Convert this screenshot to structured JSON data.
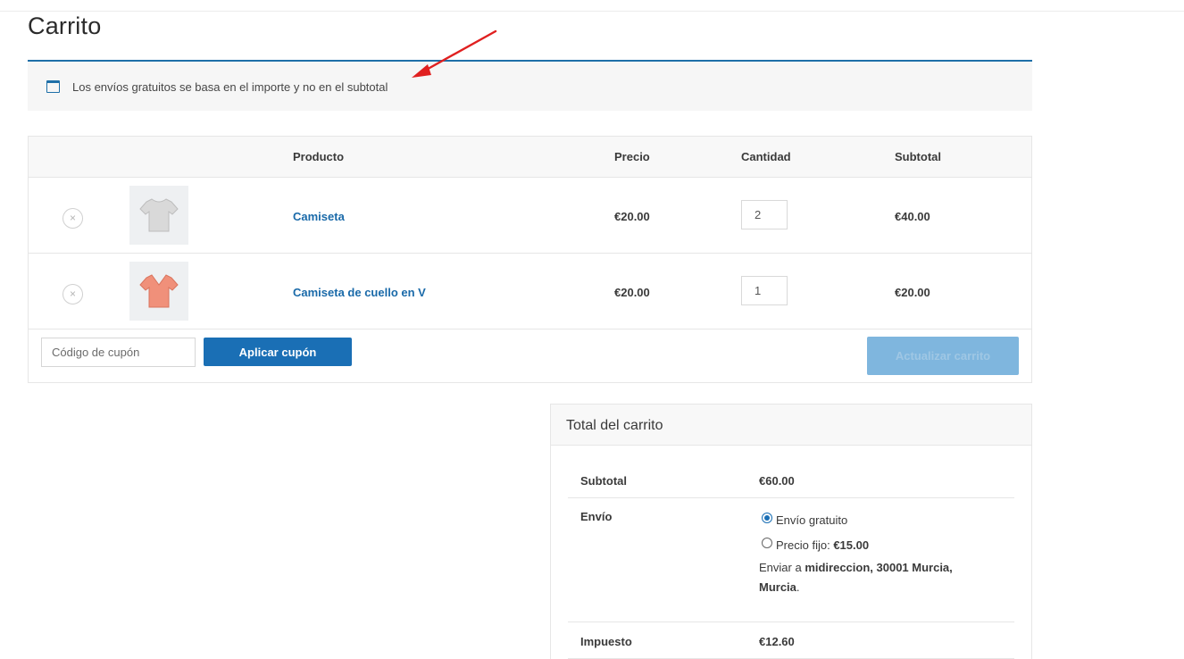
{
  "page": {
    "title": "Carrito"
  },
  "notice": {
    "text": "Los envíos gratuitos se basa en el importe y no en el subtotal",
    "accent": "#1e6fa8"
  },
  "annotation": {
    "color": "#e02020"
  },
  "table": {
    "headers": {
      "product": "Producto",
      "price": "Precio",
      "quantity": "Cantidad",
      "subtotal": "Subtotal"
    },
    "rows": [
      {
        "name": "Camiseta",
        "price": "€20.00",
        "quantity": "2",
        "subtotal": "€40.00",
        "thumb_color": "#d9d9d9",
        "remove_glyph": "×"
      },
      {
        "name": "Camiseta de cuello en V",
        "price": "€20.00",
        "quantity": "1",
        "subtotal": "€20.00",
        "thumb_color": "#f0907a",
        "remove_glyph": "×"
      }
    ]
  },
  "actions": {
    "coupon_placeholder": "Código de cupón",
    "apply_label": "Aplicar cupón",
    "update_label": "Actualizar carrito",
    "primary_color": "#1a6fb5"
  },
  "totals": {
    "title": "Total del carrito",
    "subtotal_label": "Subtotal",
    "subtotal_value": "€60.00",
    "shipping_label": "Envío",
    "shipping_options": [
      {
        "label": "Envío gratuito",
        "price": "",
        "selected": true
      },
      {
        "label": "Precio fijo: ",
        "price": "€15.00",
        "selected": false
      }
    ],
    "ship_to_prefix": "Enviar a ",
    "ship_to_address": "midireccion, 30001 Murcia, Murcia",
    "ship_to_suffix": ".",
    "tax_label": "Impuesto",
    "tax_value": "€12.60"
  }
}
